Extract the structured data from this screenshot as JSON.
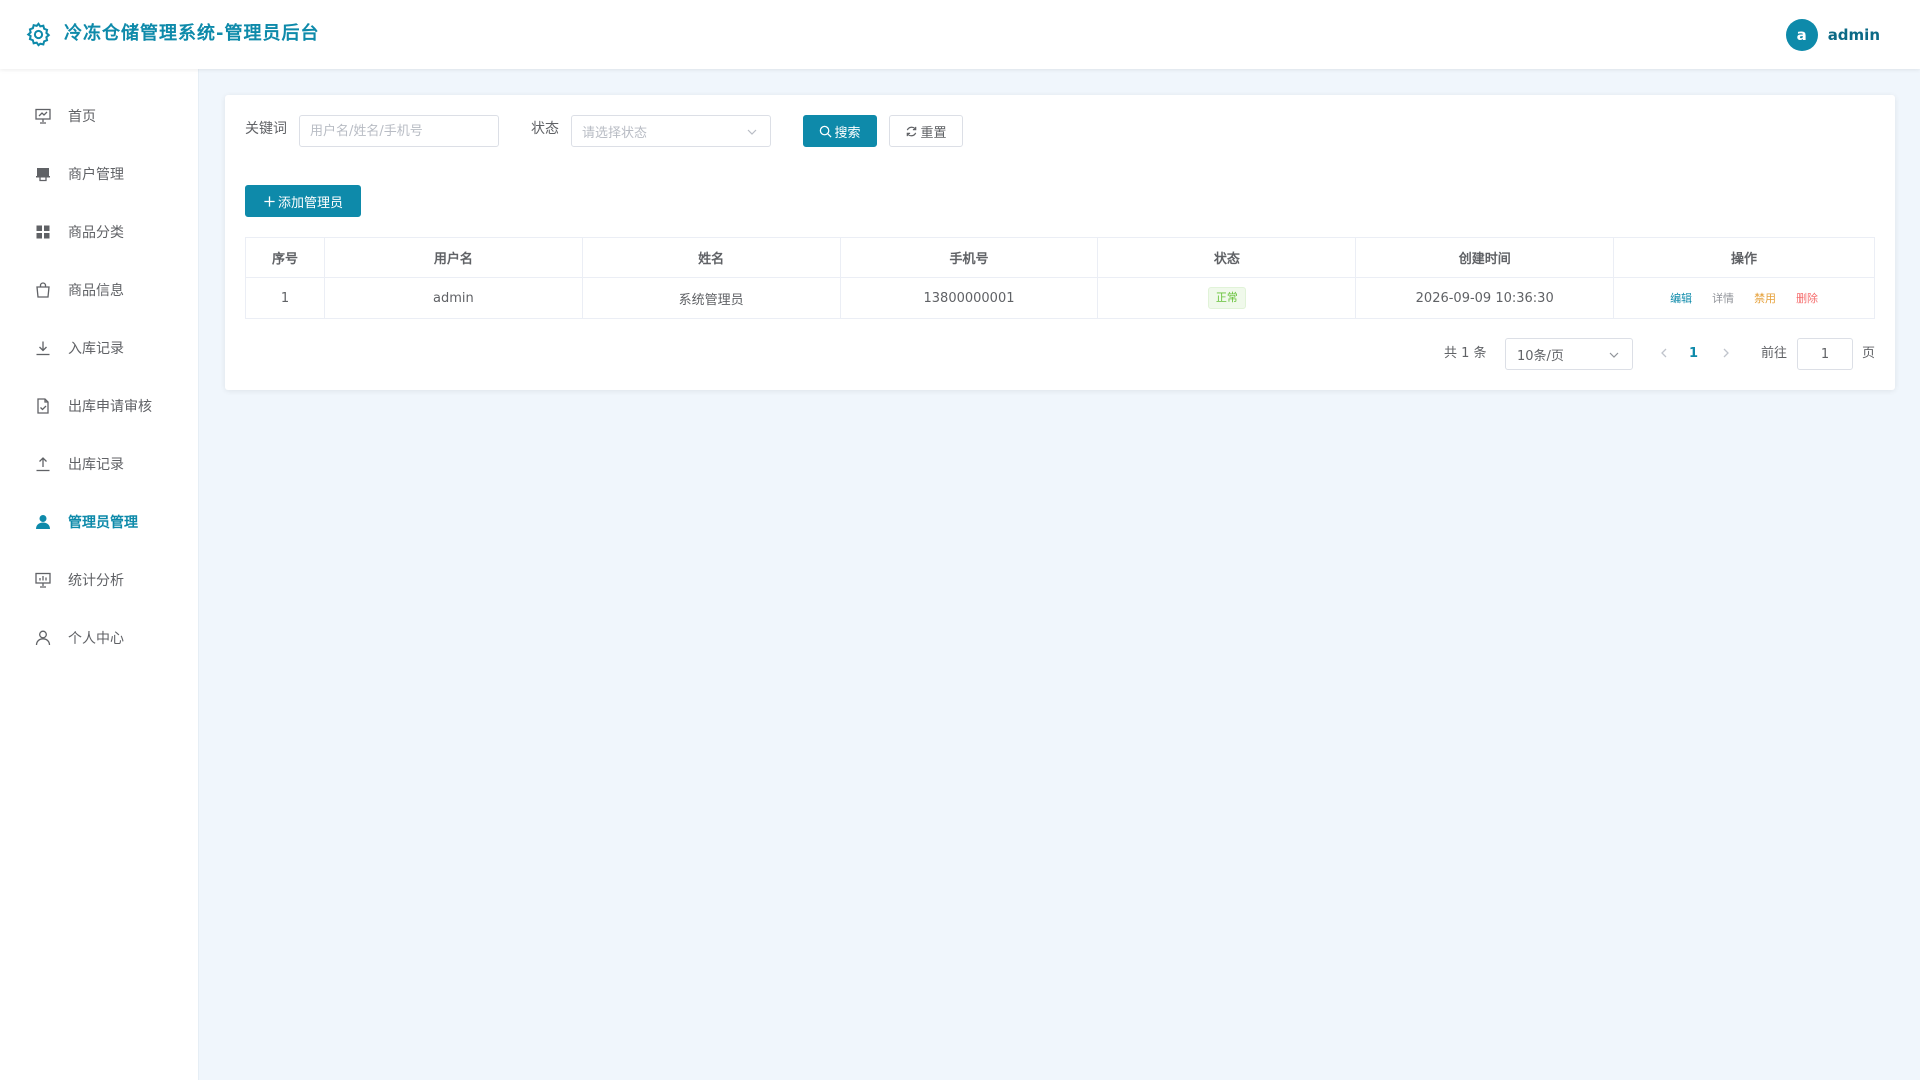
{
  "header": {
    "title": "冷冻仓储管理系统-管理员后台",
    "avatar_letter": "a",
    "username": "admin"
  },
  "sidebar": {
    "active_index": 7,
    "items": [
      {
        "label": "首页",
        "icon": "dashboard-icon"
      },
      {
        "label": "商户管理",
        "icon": "store-icon"
      },
      {
        "label": "商品分类",
        "icon": "grid-icon"
      },
      {
        "label": "商品信息",
        "icon": "bag-icon"
      },
      {
        "label": "入库记录",
        "icon": "download-icon"
      },
      {
        "label": "出库申请审核",
        "icon": "document-check-icon"
      },
      {
        "label": "出库记录",
        "icon": "upload-icon"
      },
      {
        "label": "管理员管理",
        "icon": "user-filled-icon"
      },
      {
        "label": "统计分析",
        "icon": "chart-board-icon"
      },
      {
        "label": "个人中心",
        "icon": "user-icon"
      }
    ]
  },
  "search": {
    "keyword_label": "关键词",
    "keyword_placeholder": "用户名/姓名/手机号",
    "status_label": "状态",
    "status_placeholder": "请选择状态",
    "search_button": "搜索",
    "reset_button": "重置"
  },
  "actions": {
    "add_button": "添加管理员"
  },
  "table": {
    "columns": [
      "序号",
      "用户名",
      "姓名",
      "手机号",
      "状态",
      "创建时间",
      "操作"
    ],
    "rows": [
      {
        "index": "1",
        "username": "admin",
        "name": "系统管理员",
        "phone": "13800000001",
        "status": "正常",
        "created_at": "2026-09-09 10:36:30",
        "ops": {
          "edit": "编辑",
          "detail": "详情",
          "disable": "禁用",
          "delete": "删除"
        }
      }
    ]
  },
  "pagination": {
    "total_text": "共 1 条",
    "page_size": "10条/页",
    "current_page": "1",
    "goto_label": "前往",
    "goto_value": "1",
    "page_unit": "页"
  },
  "colors": {
    "accent": "#0e8aaa",
    "status_ok": "#67c23a",
    "warning": "#e6a23c",
    "danger": "#f56c6c",
    "background": "#f0f6fc"
  }
}
